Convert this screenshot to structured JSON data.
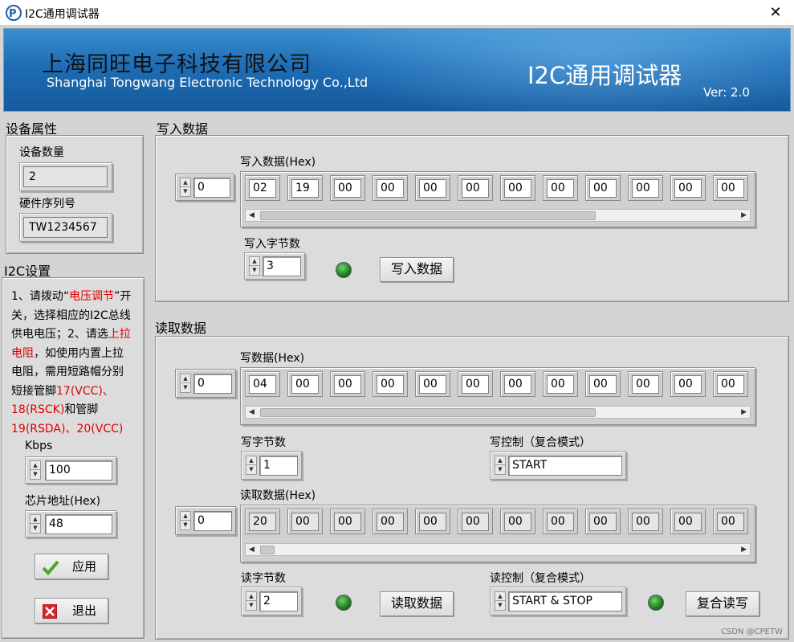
{
  "window": {
    "title": "I2C通用调试器",
    "close_symbol": "✕"
  },
  "banner": {
    "company_cn": "上海同旺电子科技有限公司",
    "company_en": "Shanghai Tongwang Electronic Technology Co.,Ltd",
    "app_title": "I2C通用调试器",
    "version": "Ver: 2.0"
  },
  "device": {
    "section_title": "设备属性",
    "count_label": "设备数量",
    "count_value": "2",
    "serial_label": "硬件序列号",
    "serial_value": "TW1234567"
  },
  "i2c": {
    "section_title": "I2C设置",
    "instructions": [
      {
        "text": "1、请拨动“",
        "red": false
      },
      {
        "text": "电压调节",
        "red": true
      },
      {
        "text": "”开关，选择相应的I2C总线供电电压；",
        "red": false
      },
      {
        "text": "2、请选",
        "red": false
      },
      {
        "text": "上拉电阻",
        "red": true
      },
      {
        "text": "，如使用内置上拉电阻，需用短路帽分别短接管脚",
        "red": false
      },
      {
        "text": "17(VCC)、18(RSCK)",
        "red": true
      },
      {
        "text": "和管脚",
        "red": false
      },
      {
        "text": "19(RSDA)、20(VCC)",
        "red": true
      }
    ],
    "kbps_label": "Kbps",
    "kbps_value": "100",
    "addr_label": "芯片地址(Hex)",
    "addr_value": "48",
    "apply_label": "应用",
    "exit_label": "退出"
  },
  "write": {
    "section_title": "写入数据",
    "index": "0",
    "data_label": "写入数据(Hex)",
    "bytes": [
      "02",
      "19",
      "00",
      "00",
      "00",
      "00",
      "00",
      "00",
      "00",
      "00",
      "00",
      "00"
    ],
    "count_label": "写入字节数",
    "count_value": "3",
    "button_label": "写入数据"
  },
  "read": {
    "section_title": "读取数据",
    "write_index": "0",
    "write_data_label": "写数据(Hex)",
    "write_bytes": [
      "04",
      "00",
      "00",
      "00",
      "00",
      "00",
      "00",
      "00",
      "00",
      "00",
      "00",
      "00"
    ],
    "write_count_label": "写字节数",
    "write_count_value": "1",
    "write_ctrl_label": "写控制（复合模式）",
    "write_ctrl_value": "START",
    "read_index": "0",
    "read_data_label": "读取数据(Hex)",
    "read_bytes": [
      "20",
      "00",
      "00",
      "00",
      "00",
      "00",
      "00",
      "00",
      "00",
      "00",
      "00",
      "00"
    ],
    "read_count_label": "读字节数",
    "read_count_value": "2",
    "read_button_label": "读取数据",
    "read_ctrl_label": "读控制（复合模式）",
    "read_ctrl_value": "START & STOP",
    "combined_button_label": "复合读写"
  },
  "watermark": "CSDN @CPETW"
}
